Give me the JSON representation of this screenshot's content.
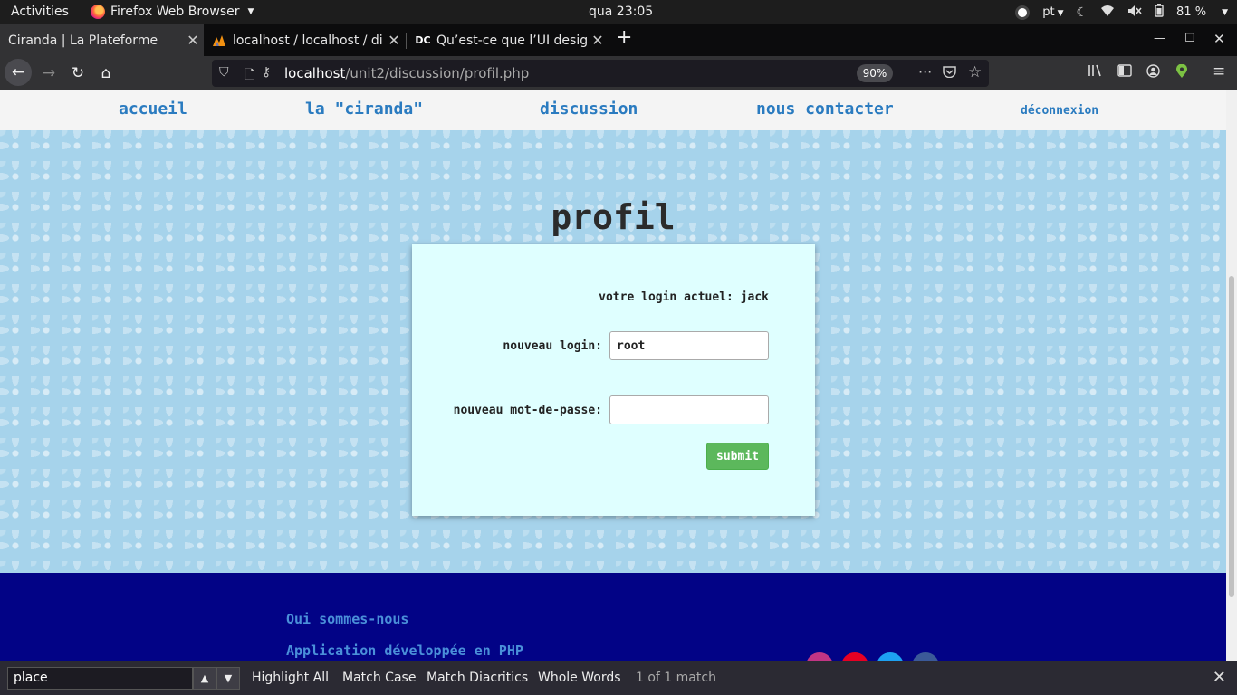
{
  "system_bar": {
    "activities": "Activities",
    "app_name": "Firefox Web Browser",
    "clock": "qua 23:05",
    "keyboard_layout": "pt",
    "battery": "81 %"
  },
  "tabs": [
    {
      "title": "Ciranda | La Plateforme",
      "favicon": "none",
      "active": true
    },
    {
      "title": "localhost / localhost / dis",
      "favicon": "phpmyadmin-icon",
      "active": false
    },
    {
      "title": "Qu’est-ce que l’UI design",
      "favicon": "dc-icon",
      "active": false
    }
  ],
  "navbar": {
    "url_host": "localhost",
    "url_path": "/unit2/discussion/profil.php",
    "zoom": "90%"
  },
  "site_nav": {
    "home": "accueil",
    "about": "la \"ciranda\"",
    "discussion": "discussion",
    "contact": "nous contacter",
    "logout": "déconnexion"
  },
  "profile": {
    "title": "profil",
    "current_login": "votre login actuel: jack",
    "new_login_label": "nouveau login:",
    "new_login_value": "root",
    "new_password_label": "nouveau mot-de-passe:",
    "new_password_value": "",
    "submit": "submit"
  },
  "footer": {
    "about": "Qui sommes-nous",
    "made_with": "Application développée en PHP"
  },
  "findbar": {
    "query": "place",
    "highlight_all": "Highlight All",
    "match_case": "Match Case",
    "match_diacritics": "Match Diacritics",
    "whole_words": "Whole Words",
    "status": "1 of 1 match"
  },
  "colors": {
    "link": "#2a7bc0",
    "pattern_bg": "#a6d3eb",
    "card_bg": "#dfffff",
    "submit_bg": "#5cb85c",
    "footer_bg": "#020386"
  }
}
